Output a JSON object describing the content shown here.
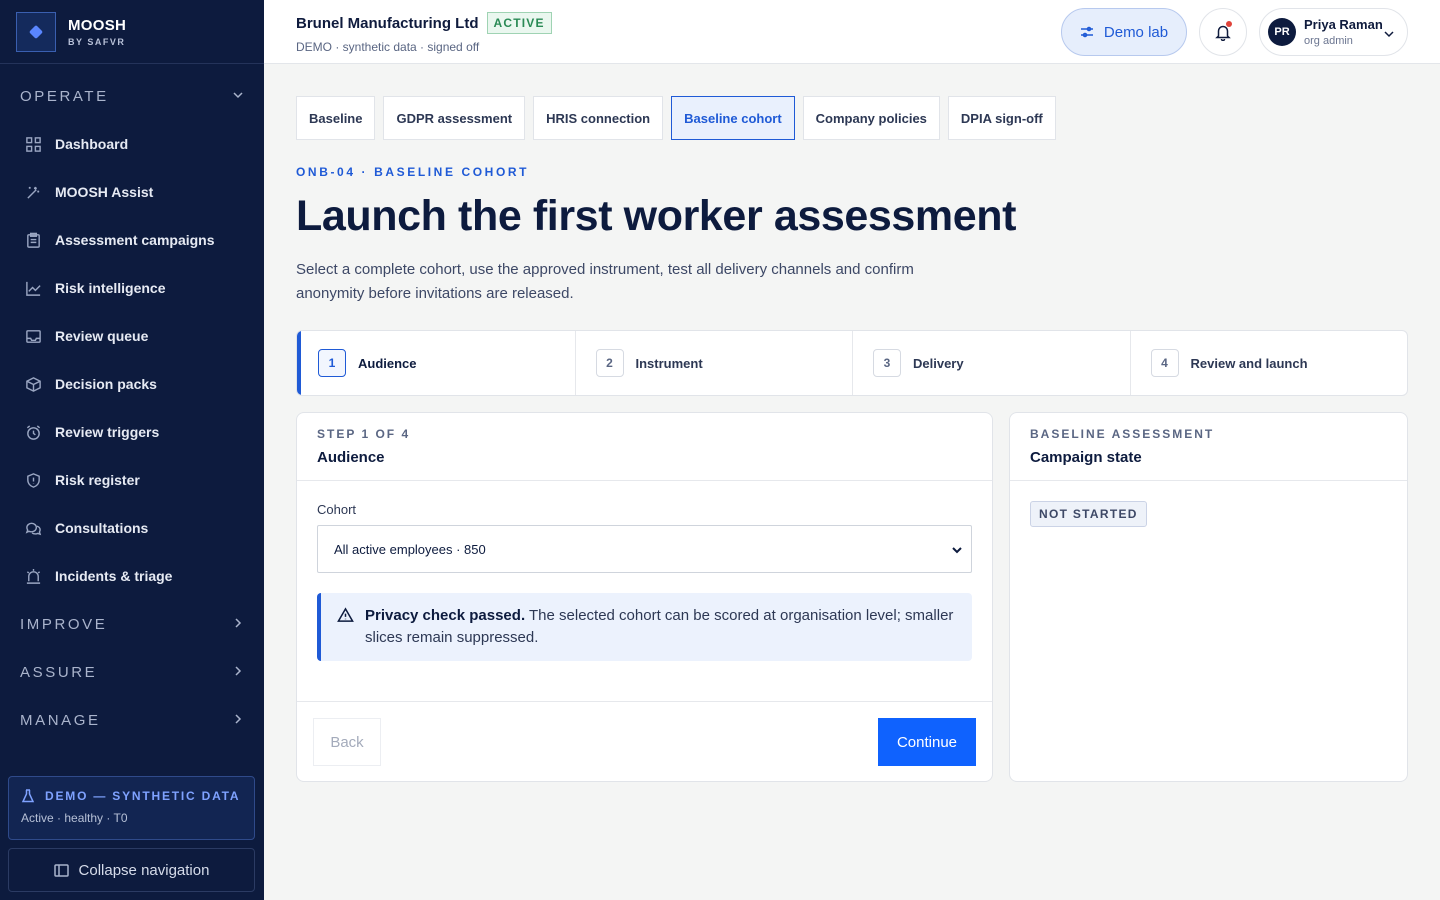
{
  "brand": {
    "name": "MOOSH",
    "sub": "BY SAFVR"
  },
  "sidebar": {
    "operate_label": "OPERATE",
    "items": [
      {
        "label": "Dashboard",
        "icon": "grid-icon"
      },
      {
        "label": "MOOSH Assist",
        "icon": "magic-wand-icon"
      },
      {
        "label": "Assessment campaigns",
        "icon": "clipboard-icon"
      },
      {
        "label": "Risk intelligence",
        "icon": "chart-line-icon"
      },
      {
        "label": "Review queue",
        "icon": "inbox-icon"
      },
      {
        "label": "Decision packs",
        "icon": "package-icon"
      },
      {
        "label": "Review triggers",
        "icon": "alarm-clock-icon"
      },
      {
        "label": "Risk register",
        "icon": "shield-icon"
      },
      {
        "label": "Consultations",
        "icon": "chat-bubbles-icon"
      },
      {
        "label": "Incidents & triage",
        "icon": "siren-icon"
      }
    ],
    "improve_label": "IMPROVE",
    "assure_label": "ASSURE",
    "manage_label": "MANAGE",
    "demo_title": "DEMO — SYNTHETIC DATA",
    "demo_status": "Active · healthy · T0",
    "collapse_label": "Collapse navigation"
  },
  "header": {
    "org_name": "Brunel Manufacturing Ltd",
    "org_status": "ACTIVE",
    "org_meta": "DEMO · synthetic data · signed off",
    "demo_lab_label": "Demo lab",
    "user_initials": "PR",
    "user_name": "Priya Raman",
    "user_role": "org admin"
  },
  "tabs": [
    {
      "label": "Baseline",
      "active": false
    },
    {
      "label": "GDPR assessment",
      "active": false
    },
    {
      "label": "HRIS connection",
      "active": false
    },
    {
      "label": "Baseline cohort",
      "active": true
    },
    {
      "label": "Company policies",
      "active": false
    },
    {
      "label": "DPIA sign-off",
      "active": false
    }
  ],
  "page": {
    "eyebrow": "ONB-04 · BASELINE COHORT",
    "title": "Launch the first worker assessment",
    "subtitle": "Select a complete cohort, use the approved instrument, test all delivery channels and confirm anonymity before invitations are released."
  },
  "steps": [
    {
      "num": "1",
      "label": "Audience",
      "active": true
    },
    {
      "num": "2",
      "label": "Instrument",
      "active": false
    },
    {
      "num": "3",
      "label": "Delivery",
      "active": false
    },
    {
      "num": "4",
      "label": "Review and launch",
      "active": false
    }
  ],
  "main_panel": {
    "eyebrow": "STEP 1 OF 4",
    "title": "Audience",
    "cohort_label": "Cohort",
    "cohort_value": "All active employees · 850",
    "alert_bold": "Privacy check passed.",
    "alert_text": " The selected cohort can be scored at organisation level; smaller slices remain suppressed.",
    "back_label": "Back",
    "continue_label": "Continue"
  },
  "side_panel": {
    "eyebrow": "BASELINE ASSESSMENT",
    "title": "Campaign state",
    "state": "NOT STARTED"
  },
  "colors": {
    "sidebar_bg": "#0d1b3e",
    "accent": "#1f5ad6",
    "primary_button": "#0f62fe",
    "active_badge": "#2a8a55"
  }
}
